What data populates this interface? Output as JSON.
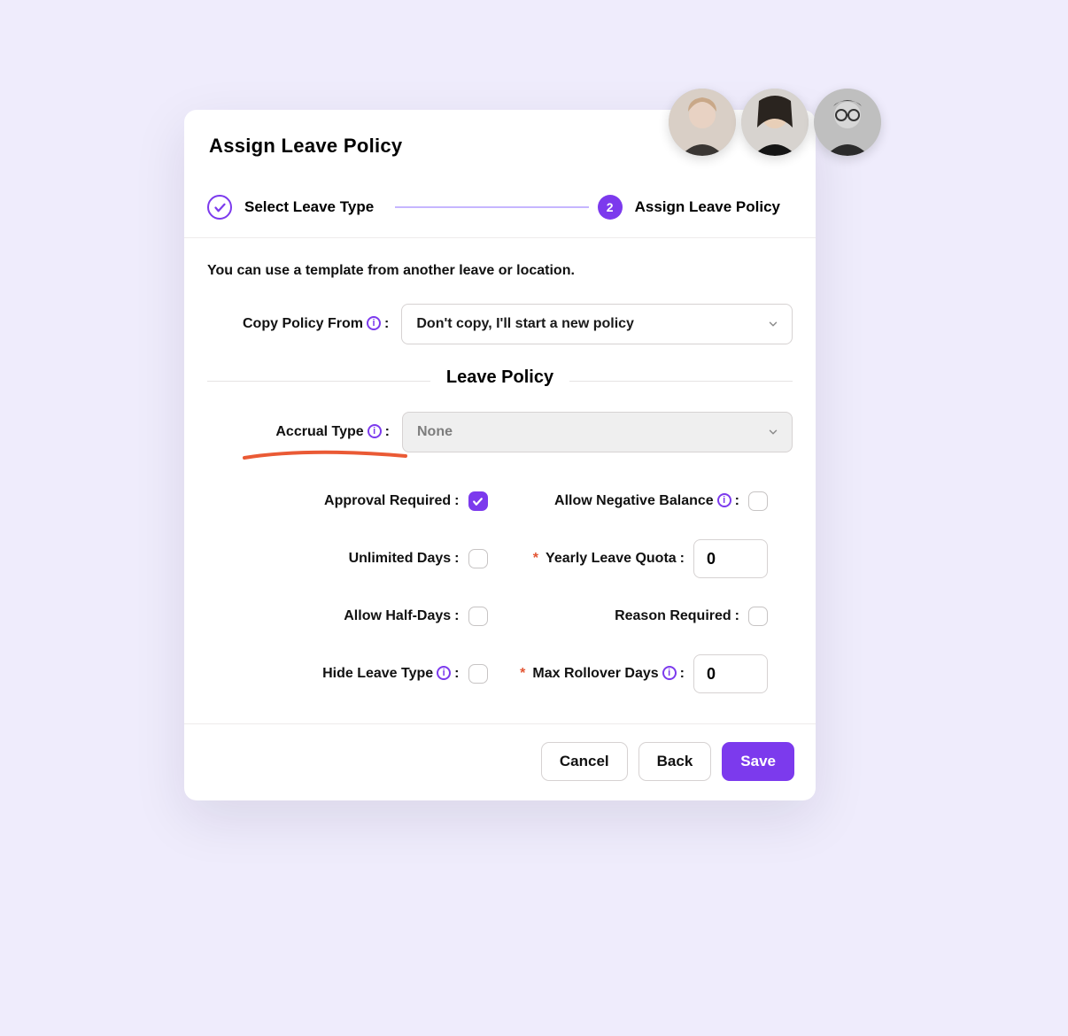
{
  "title": "Assign Leave Policy",
  "stepper": {
    "step1_label": "Select Leave Type",
    "step2_number": "2",
    "step2_label": "Assign Leave Policy"
  },
  "intro": "You can use a template from another leave or location.",
  "copy_policy": {
    "label": "Copy Policy From",
    "selected": "Don't copy, I'll start a new policy"
  },
  "section_title": "Leave Policy",
  "accrual": {
    "label": "Accrual Type",
    "selected": "None"
  },
  "fields": {
    "approval_required": {
      "label": "Approval Required",
      "checked": true
    },
    "allow_negative": {
      "label": "Allow Negative Balance",
      "checked": false
    },
    "unlimited_days": {
      "label": "Unlimited Days",
      "checked": false
    },
    "yearly_quota": {
      "label": "Yearly Leave Quota",
      "value": "0",
      "required": true
    },
    "allow_half_days": {
      "label": "Allow Half-Days",
      "checked": false
    },
    "reason_required": {
      "label": "Reason Required",
      "checked": false
    },
    "hide_leave_type": {
      "label": "Hide Leave Type",
      "checked": false
    },
    "max_rollover": {
      "label": "Max Rollover Days",
      "value": "0",
      "required": true
    }
  },
  "buttons": {
    "cancel": "Cancel",
    "back": "Back",
    "save": "Save"
  },
  "colors": {
    "accent": "#7c3aed",
    "bg": "#efecfc",
    "underline": "#ea5a35"
  }
}
